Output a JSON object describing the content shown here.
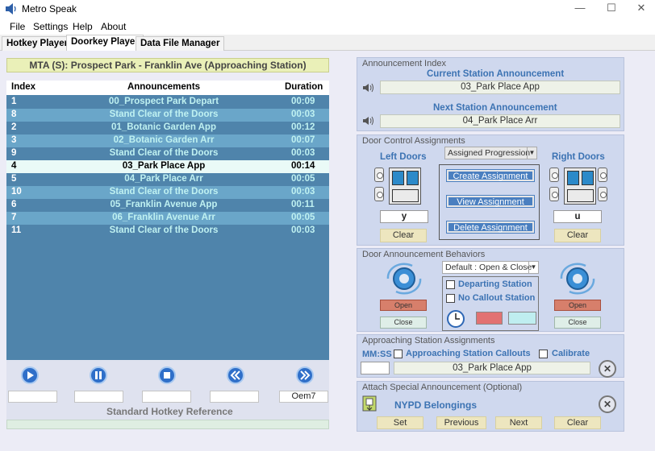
{
  "window": {
    "title": "Metro Speak",
    "minimize": "—",
    "maximize": "☐",
    "close": "✕"
  },
  "menu": [
    "File",
    "Settings",
    "Help",
    "About"
  ],
  "tabs": [
    "Hotkey Player",
    "Doorkey Player",
    "Data File Manager"
  ],
  "station_banner": "MTA (S): Prospect Park - Franklin Ave (Approaching Station)",
  "table": {
    "headers": [
      "Index",
      "Announcements",
      "Duration"
    ],
    "rows": [
      {
        "index": "1",
        "announcement": "00_Prospect Park Depart",
        "duration": "00:09"
      },
      {
        "index": "8",
        "announcement": "Stand Clear of the Doors",
        "duration": "00:03"
      },
      {
        "index": "2",
        "announcement": "01_Botanic Garden App",
        "duration": "00:12"
      },
      {
        "index": "3",
        "announcement": "02_Botanic Garden Arr",
        "duration": "00:07"
      },
      {
        "index": "9",
        "announcement": "Stand Clear of the Doors",
        "duration": "00:03"
      },
      {
        "index": "4",
        "announcement": "03_Park Place App",
        "duration": "00:14"
      },
      {
        "index": "5",
        "announcement": "04_Park Place Arr",
        "duration": "00:05"
      },
      {
        "index": "10",
        "announcement": "Stand Clear of the Doors",
        "duration": "00:03"
      },
      {
        "index": "6",
        "announcement": "05_Franklin Avenue App",
        "duration": "00:11"
      },
      {
        "index": "7",
        "announcement": "06_Franklin Avenue Arr",
        "duration": "00:05"
      },
      {
        "index": "11",
        "announcement": "Stand Clear of the Doors",
        "duration": "00:03"
      }
    ],
    "selected_index": 5
  },
  "player": {
    "last_key": "Oem7",
    "reference_label": "Standard Hotkey Reference"
  },
  "announcement_index": {
    "title": "Announcement Index",
    "current_label": "Current Station Announcement",
    "current_value": "03_Park Place App",
    "next_label": "Next Station Announcement",
    "next_value": "04_Park Place Arr"
  },
  "door_control": {
    "title": "Door Control Assignments",
    "left_label": "Left Doors",
    "right_label": "Right Doors",
    "dropdown": "Assigned Progression",
    "left_key": "y",
    "right_key": "u",
    "clear": "Clear",
    "create": "Create Assignment",
    "view": "View Assignment",
    "delete": "Delete Assignment"
  },
  "door_behaviors": {
    "title": "Door Announcement Behaviors",
    "dropdown": "Default : Open & Close",
    "departing": "Departing Station",
    "no_callout": "No Callout Station",
    "open": "Open",
    "close": "Close",
    "colors": {
      "red": "#e27272",
      "cyan": "#bfeef0"
    }
  },
  "approaching": {
    "title": "Approaching Station Assignments",
    "mmss": "MM:SS",
    "callouts": "Approaching Station Callouts",
    "calibrate": "Calibrate",
    "value": "03_Park Place App"
  },
  "special": {
    "title": "Attach Special Announcement (Optional)",
    "name": "NYPD Belongings",
    "set": "Set",
    "previous": "Previous",
    "next": "Next",
    "clear": "Clear"
  }
}
